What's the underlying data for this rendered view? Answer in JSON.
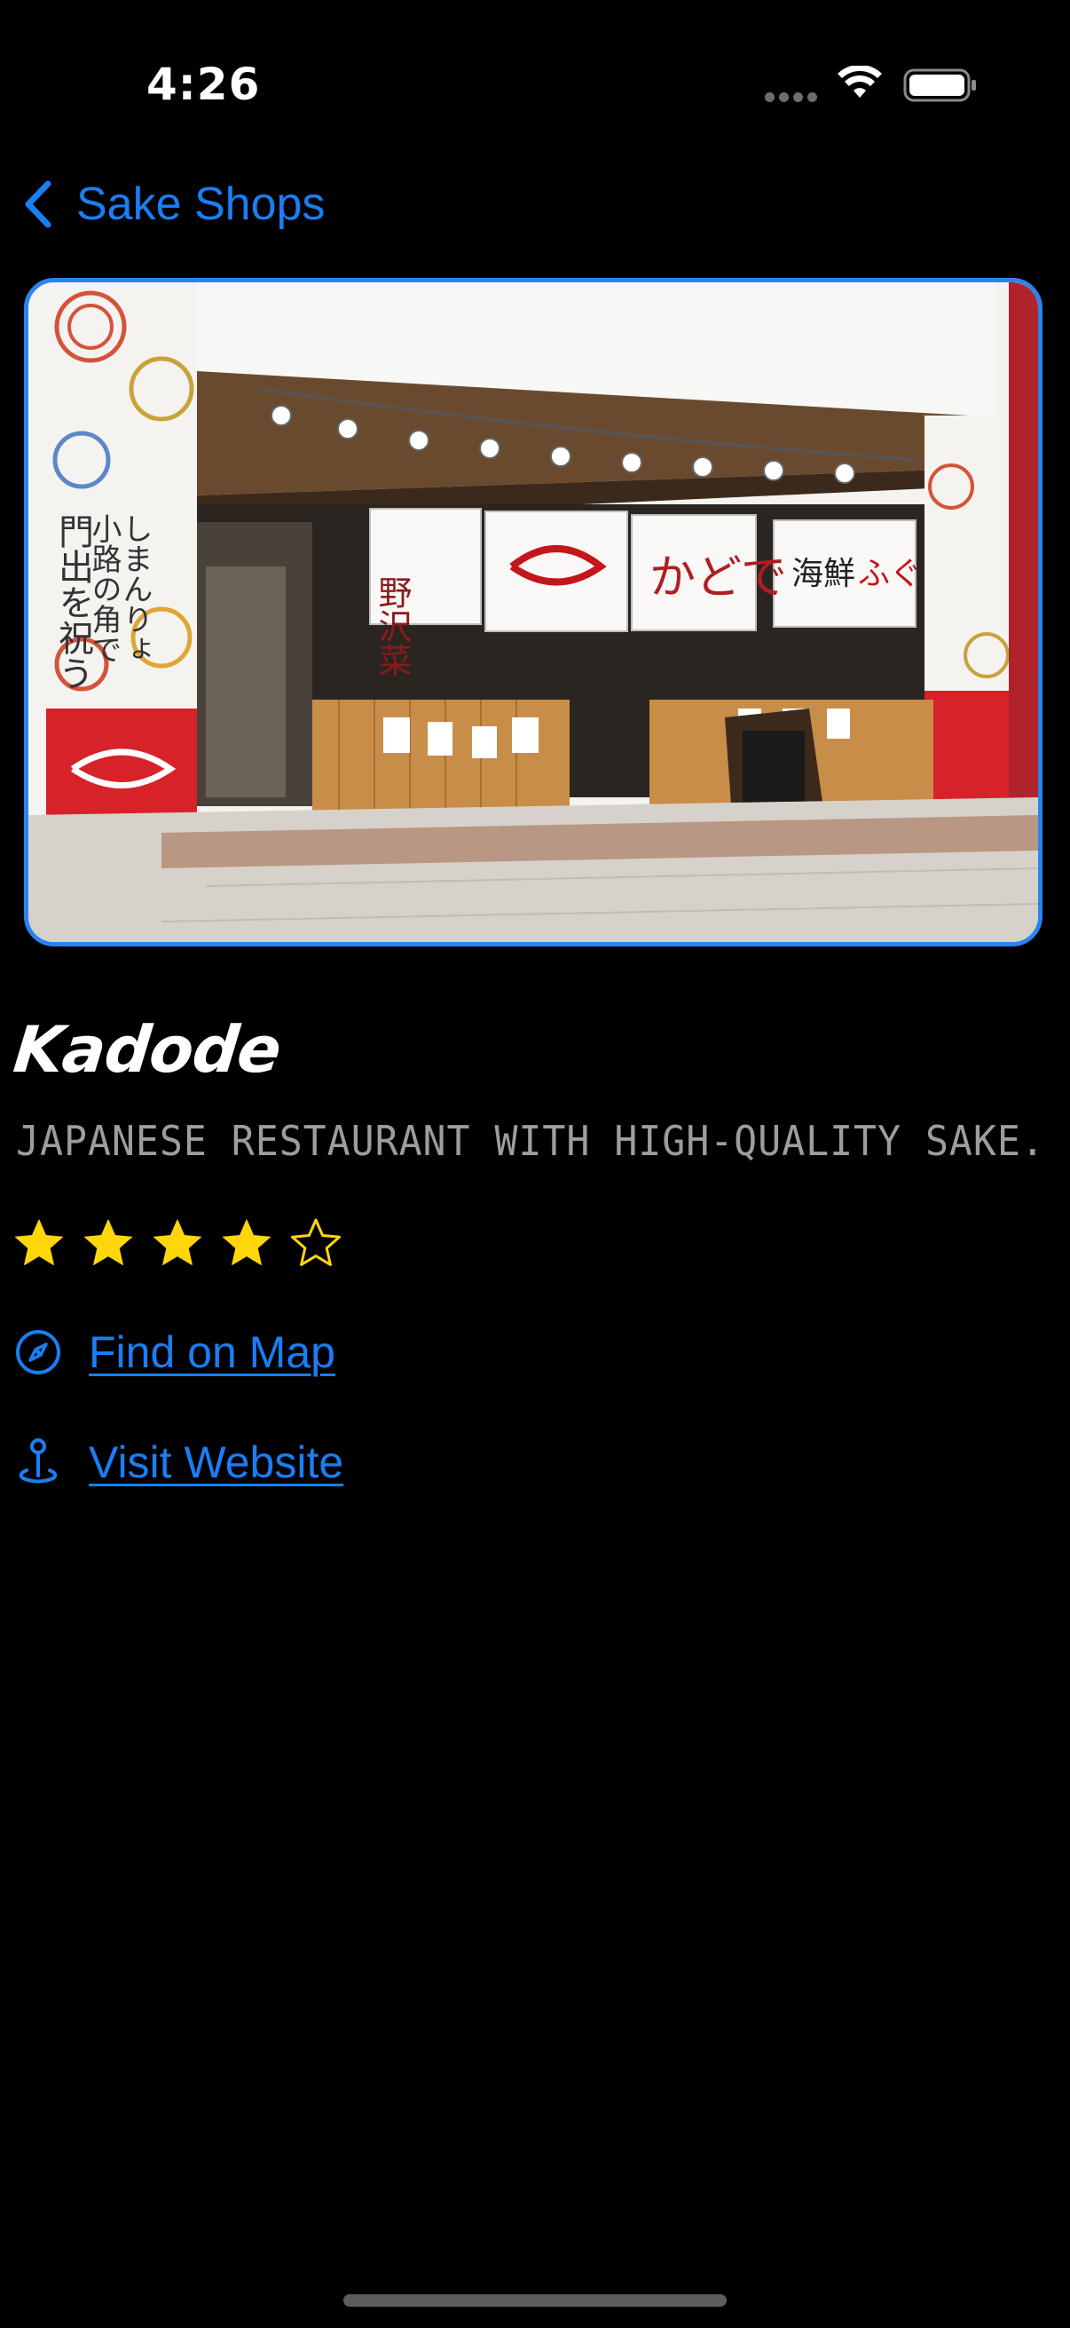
{
  "status_bar": {
    "time": "4:26"
  },
  "nav": {
    "back_label": "Sake Shops",
    "back_icon": "chevron-left-icon"
  },
  "shop": {
    "name": "Kadode",
    "description": "JAPANESE RESTAURANT WITH HIGH-QUALITY SAKE.",
    "rating": 4,
    "rating_max": 5,
    "star_color": "#ffd60a"
  },
  "links": {
    "map_label": "Find on Map",
    "map_icon": "compass-icon",
    "website_label": "Visit Website",
    "website_icon": "location-pin-icon"
  },
  "colors": {
    "accent": "#1a7ef5",
    "background": "#000000",
    "secondary_text": "#9d9d9d"
  }
}
